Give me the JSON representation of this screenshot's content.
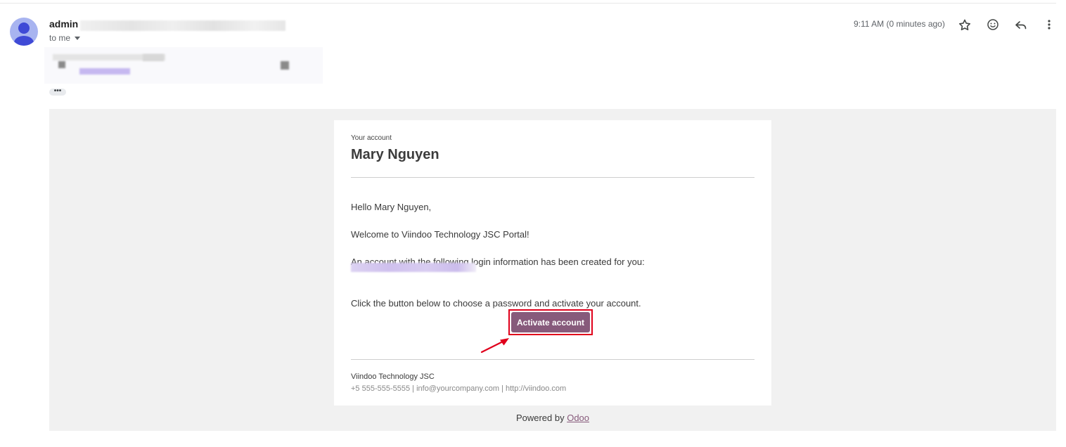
{
  "header": {
    "sender_name": "admin",
    "recipient_line": "to me",
    "timestamp": "9:11 AM (0 minutes ago)",
    "icons": [
      "star-icon",
      "emoji-icon",
      "reply-icon",
      "more-vert-icon"
    ],
    "show_trimmed_label": "•••"
  },
  "email": {
    "subtitle": "Your account",
    "name": "Mary Nguyen",
    "greeting": "Hello Mary Nguyen,",
    "welcome": "Welcome to Viindoo Technology JSC Portal!",
    "info_line": "An account with the following login information has been created for you:",
    "instruction": "Click the button below to choose a password and activate your account.",
    "activate_button": "Activate account",
    "company": "Viindoo Technology JSC",
    "contact": "+5 555-555-5555 | info@yourcompany.com | http://viindoo.com",
    "powered_prefix": "Powered by ",
    "powered_link": "Odoo"
  },
  "colors": {
    "brand": "#875a7b",
    "highlight": "#e0001b",
    "frame_bg": "#f1f1f1"
  }
}
